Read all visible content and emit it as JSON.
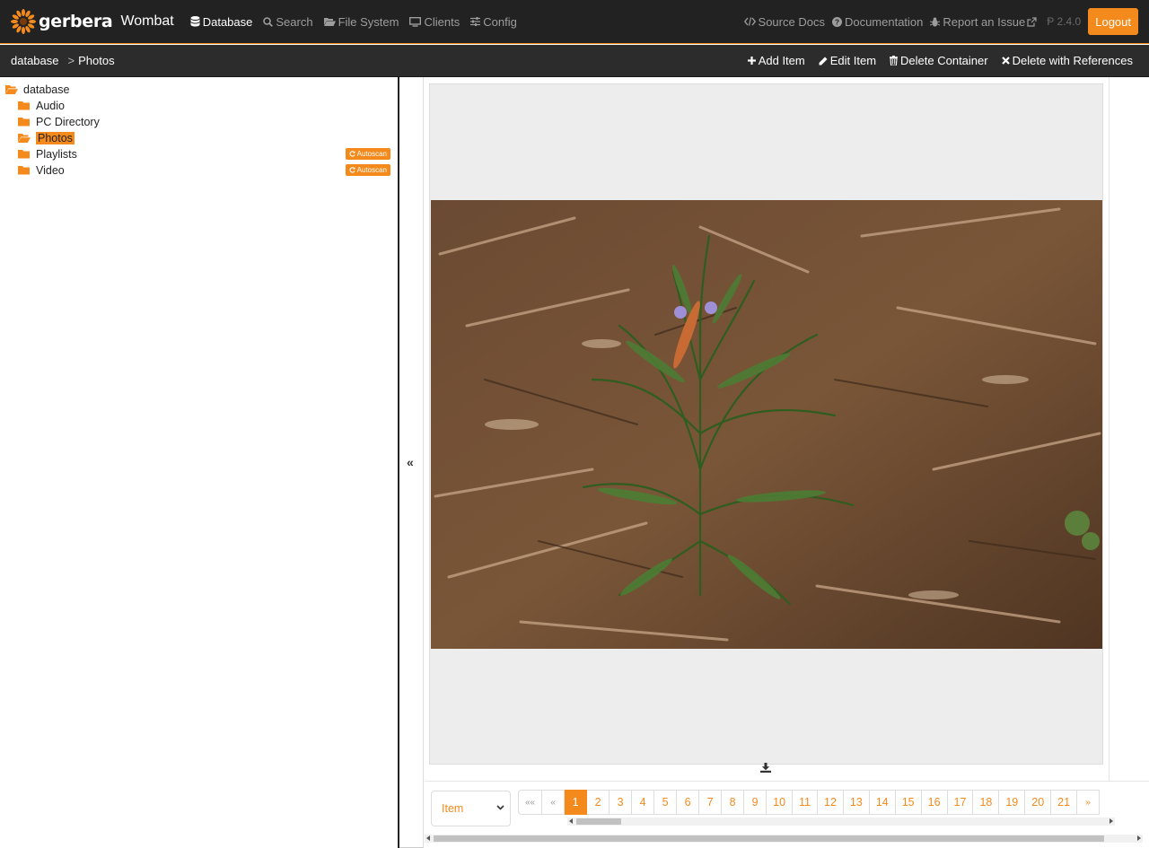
{
  "app": {
    "brand": "gerbera",
    "version_name": "Wombat"
  },
  "nav": {
    "items": [
      {
        "label": "Database",
        "icon": "database-icon",
        "active": true
      },
      {
        "label": "Search",
        "icon": "search-icon"
      },
      {
        "label": "File System",
        "icon": "folder-open-icon"
      },
      {
        "label": "Clients",
        "icon": "monitor-icon"
      },
      {
        "label": "Config",
        "icon": "sliders-icon"
      }
    ],
    "right": [
      {
        "label": "Source Docs",
        "icon": "code-icon"
      },
      {
        "label": "Documentation",
        "icon": "question-circle-icon"
      },
      {
        "label": "Report an Issue",
        "icon": "bug-icon"
      }
    ],
    "version": "2.4.0",
    "logout_label": "Logout"
  },
  "breadcrumb": {
    "items": [
      "database",
      "Photos"
    ],
    "separator": ">"
  },
  "toolbar": {
    "add_item": "Add Item",
    "edit_item": "Edit Item",
    "delete_container": "Delete Container",
    "delete_with_references": "Delete with References"
  },
  "tree": {
    "root": "database",
    "children": [
      {
        "label": "Audio"
      },
      {
        "label": "PC Directory"
      },
      {
        "label": "Photos",
        "selected": true
      },
      {
        "label": "Playlists",
        "badge": "Autoscan"
      },
      {
        "label": "Video",
        "badge": "Autoscan"
      }
    ]
  },
  "collapse_label": "«",
  "pager": {
    "type_select": "Item",
    "first": "««",
    "prev": "«",
    "pages": [
      "1",
      "2",
      "3",
      "4",
      "5",
      "6",
      "7",
      "8",
      "9",
      "10",
      "11",
      "12",
      "13",
      "14",
      "15",
      "16",
      "17",
      "18",
      "19",
      "20",
      "21"
    ],
    "current": "1",
    "next": "»"
  },
  "colors": {
    "accent": "#f48a1c",
    "navbar": "#222222",
    "crumbbar": "#2c2c2c"
  }
}
